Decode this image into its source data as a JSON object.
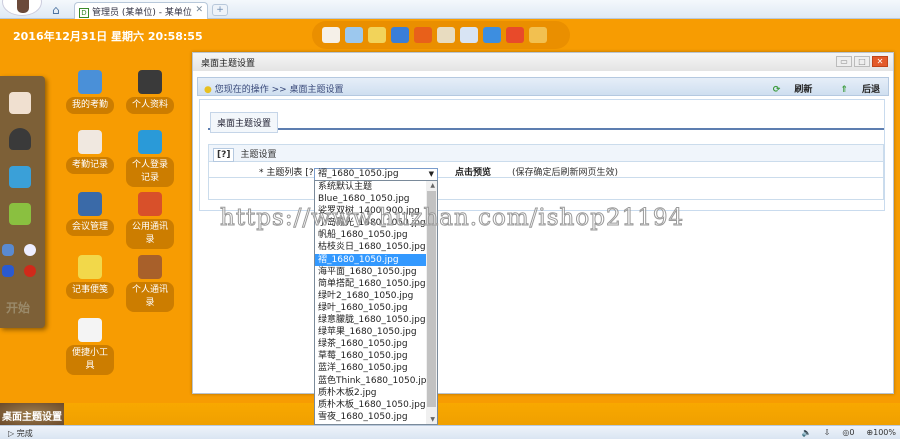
{
  "browser": {
    "tab_title": "管理员 (某单位) - 某单位",
    "tab_icon": "D",
    "new_tab": "+",
    "close": "✕"
  },
  "clock": "2016年12月31日 星期六 20:58:55",
  "top_dock": [
    {
      "icon": "home-icon",
      "color": "#f5f0e8"
    },
    {
      "icon": "window-icon",
      "color": "#9cc8ee"
    },
    {
      "icon": "mail-icon",
      "color": "#f2d35a"
    },
    {
      "icon": "refresh-icon",
      "color": "#3a7ed8"
    },
    {
      "icon": "rss-icon",
      "color": "#e8601a"
    },
    {
      "icon": "notepad-icon",
      "color": "#e8dcc0"
    },
    {
      "icon": "calendar-icon",
      "color": "#d8e4f4"
    },
    {
      "icon": "globe-icon",
      "color": "#3d8ee0"
    },
    {
      "icon": "lifebuoy-icon",
      "color": "#e84a2a"
    },
    {
      "icon": "grid-icon",
      "color": "#f2c050"
    }
  ],
  "left_dock": {
    "start": "开始"
  },
  "desktop_icons": [
    {
      "label": "我的考勤",
      "color": "#4a90d8"
    },
    {
      "label": "个人资料",
      "color": "#3a3a3a"
    },
    {
      "label": "考勤记录",
      "color": "#f0e8e0"
    },
    {
      "label": "个人登录记录",
      "color": "#2a9ad8"
    },
    {
      "label": "会议管理",
      "color": "#3a6aa8"
    },
    {
      "label": "公用通讯录",
      "color": "#d8502a"
    },
    {
      "label": "记事便笺",
      "color": "#f2d84a"
    },
    {
      "label": "个人通讯录",
      "color": "#a8602a"
    },
    {
      "label": "便捷小工具",
      "color": "#f4f4f4"
    }
  ],
  "window": {
    "title": "桌面主题设置",
    "breadcrumb": "您现在的操作 >> 桌面主题设置",
    "refresh": "刷新",
    "back": "后退",
    "tab": "桌面主题设置",
    "section_help": "[?]",
    "section_title": "主题设置",
    "field_label": "* 主题列表 [?]",
    "selected": "褶_1680_1050.jpg",
    "preview": "点击预览",
    "note": "(保存确定后刷新网页生效)"
  },
  "dropdown_options": [
    "系统默认主题",
    "Blue_1680_1050.jpg",
    "娑罗双树_1400_900.jpg",
    "小岛霞光_1680_1050.jpg",
    "帆船_1680_1050.jpg",
    "枯枝炎日_1680_1050.jpg",
    "褶_1680_1050.jpg",
    "海平面_1680_1050.jpg",
    "简单搭配_1680_1050.jpg",
    "绿叶2_1680_1050.jpg",
    "绿叶_1680_1050.jpg",
    "绿意朦胧_1680_1050.jpg",
    "绿苹果_1680_1050.jpg",
    "绿茶_1680_1050.jpg",
    "草莓_1680_1050.jpg",
    "蓝洋_1680_1050.jpg",
    "蓝色Think_1680_1050.jpg",
    "质朴木板2.jpg",
    "质朴木板_1680_1050.jpg",
    "雪夜_1680_1050.jpg"
  ],
  "selected_index": 6,
  "watermark": "https://www.huzhan.com/ishop21194",
  "taskbar": {
    "task": "桌面主题设置"
  },
  "status": {
    "text": "完成",
    "count": "0",
    "zoom": "100%"
  }
}
